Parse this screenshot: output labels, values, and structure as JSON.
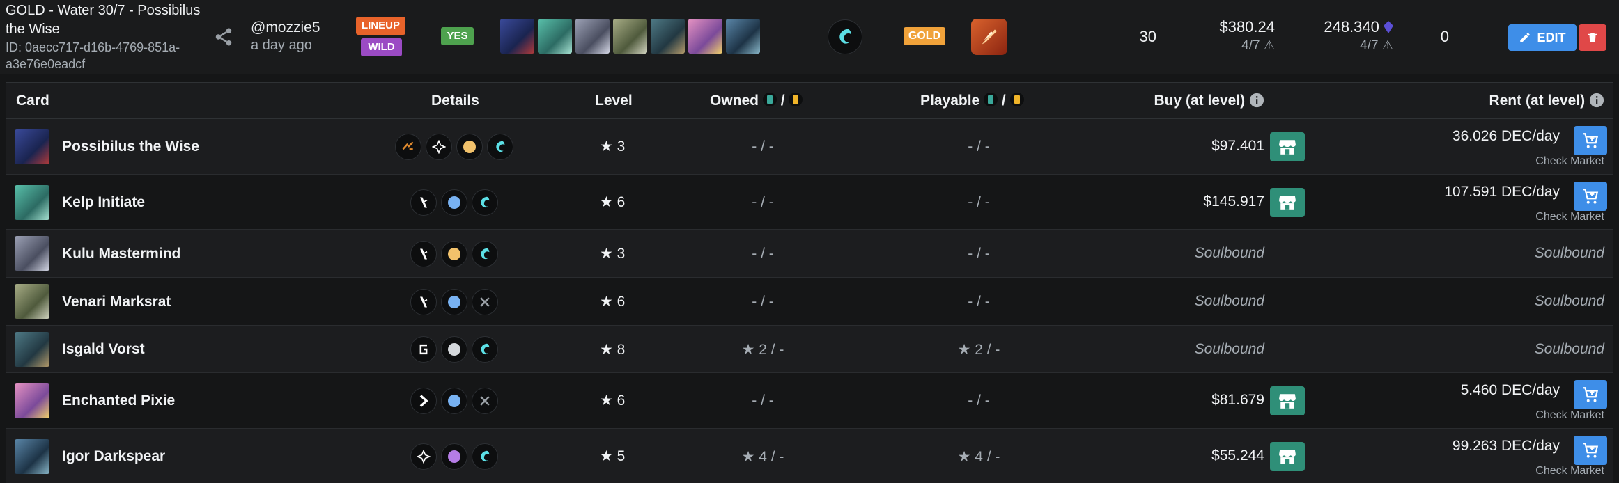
{
  "summary": {
    "title": "GOLD - Water 30/7 - Possibilus the Wise",
    "id_line": "ID: 0aecc717-d16b-4769-851a-a3e76e0eadcf",
    "user": "@mozzie5",
    "time": "a day ago",
    "badge_lineup": "LINEUP",
    "badge_wild": "WILD",
    "badge_yes": "YES",
    "badge_gold": "GOLD",
    "mana": "30",
    "price": "$380.24",
    "price_sub": "4/7",
    "dec": "248.340",
    "dec_sub": "4/7",
    "zero": "0",
    "edit_label": "EDIT",
    "element_icon": "water-swirl-icon",
    "ability_icon": "fire-slash-icon"
  },
  "thumb_colors": [
    "#3a4a9a",
    "#3f9a8a",
    "#7a7f92",
    "#8a8f6a",
    "#3d5a66",
    "#c77aa6",
    "#3e5f7a"
  ],
  "table": {
    "headers": {
      "card": "Card",
      "details": "Details",
      "level": "Level",
      "owned": "Owned",
      "playable": "Playable",
      "buy": "Buy (at level)",
      "rent": "Rent (at level)",
      "slash": "/"
    },
    "rows": [
      {
        "name": "Possibilus the Wise",
        "level": "3",
        "owned": "- / -",
        "playable": "- / -",
        "buy": "$97.401",
        "rent": "36.026 DEC/day",
        "check": "Check Market",
        "color": "#3a4a9a"
      },
      {
        "name": "Kelp Initiate",
        "level": "6",
        "owned": "- / -",
        "playable": "- / -",
        "buy": "$145.917",
        "rent": "107.591 DEC/day",
        "check": "Check Market",
        "color": "#3f9a8a"
      },
      {
        "name": "Kulu Mastermind",
        "level": "3",
        "owned": "- / -",
        "playable": "- / -",
        "buy": "Soulbound",
        "rent": "Soulbound",
        "color": "#7a7f92"
      },
      {
        "name": "Venari Marksrat",
        "level": "6",
        "owned": "- / -",
        "playable": "- / -",
        "buy": "Soulbound",
        "rent": "Soulbound",
        "color": "#8a8f6a"
      },
      {
        "name": "Isgald Vorst",
        "level": "8",
        "owned": "2 / -",
        "playable": "2 / -",
        "buy": "Soulbound",
        "rent": "Soulbound",
        "color": "#3d5a66"
      },
      {
        "name": "Enchanted Pixie",
        "level": "6",
        "owned": "- / -",
        "playable": "- / -",
        "buy": "$81.679",
        "rent": "5.460 DEC/day",
        "check": "Check Market",
        "color": "#c77aa6"
      },
      {
        "name": "Igor Darkspear",
        "level": "5",
        "owned": "4 / -",
        "playable": "4 / -",
        "buy": "$55.244",
        "rent": "99.263 DEC/day",
        "check": "Check Market",
        "color": "#3e5f7a"
      }
    ]
  }
}
